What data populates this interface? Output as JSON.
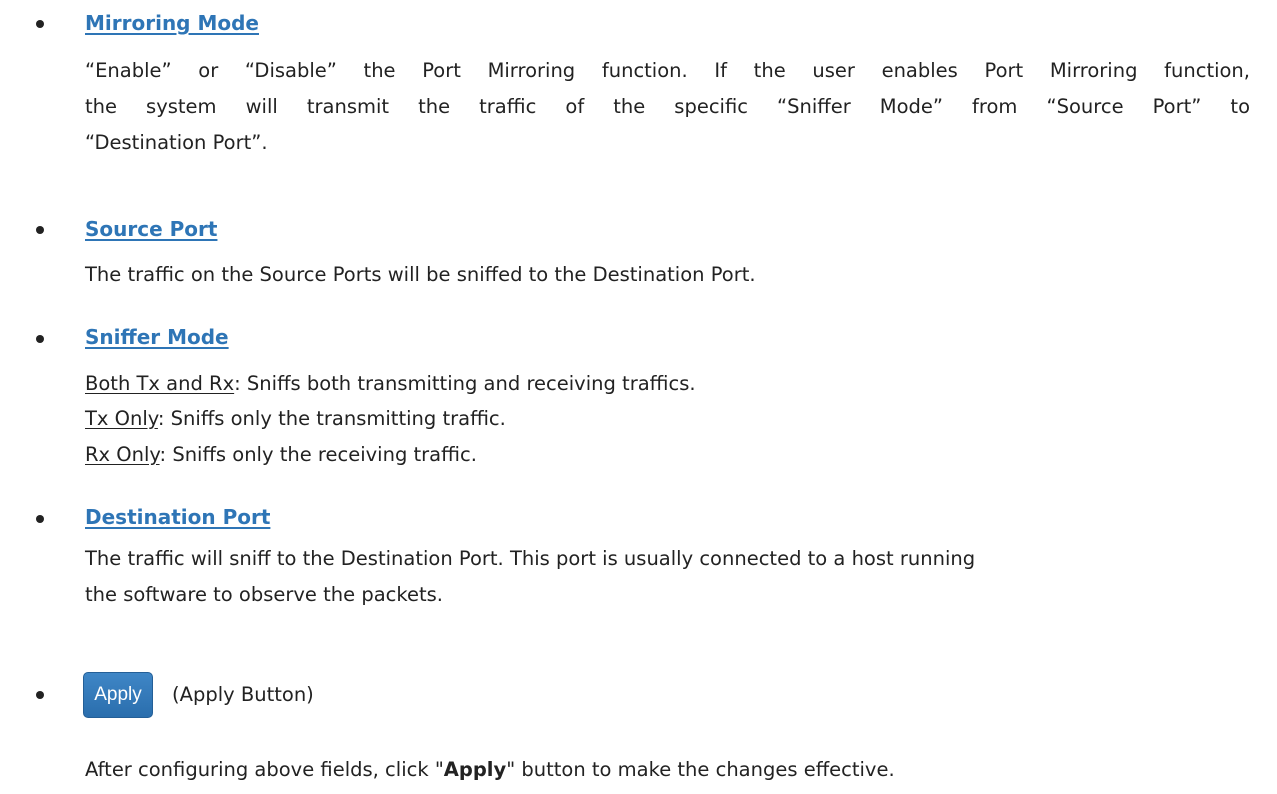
{
  "sections": [
    {
      "heading": "Mirroring Mode",
      "text_lines": [
        "“Enable” or “Disable” the Port Mirroring function. If the user enables Port Mirroring function,",
        "the system will transmit the traffic of the specific “Sniffer Mode” from “Source Port” to",
        "“Destination Port”."
      ]
    },
    {
      "heading": "Source Port",
      "text": "The traffic on the Source Ports will be sniffed to the Destination Port."
    },
    {
      "heading": "Sniffer Mode",
      "modes": [
        {
          "term": "Both Tx and Rx",
          "desc": ": Sniffs both transmitting and receiving traffics."
        },
        {
          "term": "Tx Only",
          "desc": ": Sniffs only the transmitting traffic."
        },
        {
          "term": "Rx Only",
          "desc": ": Sniffs only the receiving traffic."
        }
      ]
    },
    {
      "heading": "Destination Port",
      "text_lines": [
        "The traffic will sniff to the Destination Port. This port is usually connected to a host running",
        "the software to observe the packets."
      ]
    }
  ],
  "apply": {
    "button_label": "Apply",
    "caption": "(Apply Button)",
    "description_before": "After configuring above fields, click \"",
    "description_bold": "Apply",
    "description_after": "\" button to make the changes effective."
  },
  "colors": {
    "heading": "#2e75b6",
    "text": "#222222",
    "button": "#3476b8"
  }
}
